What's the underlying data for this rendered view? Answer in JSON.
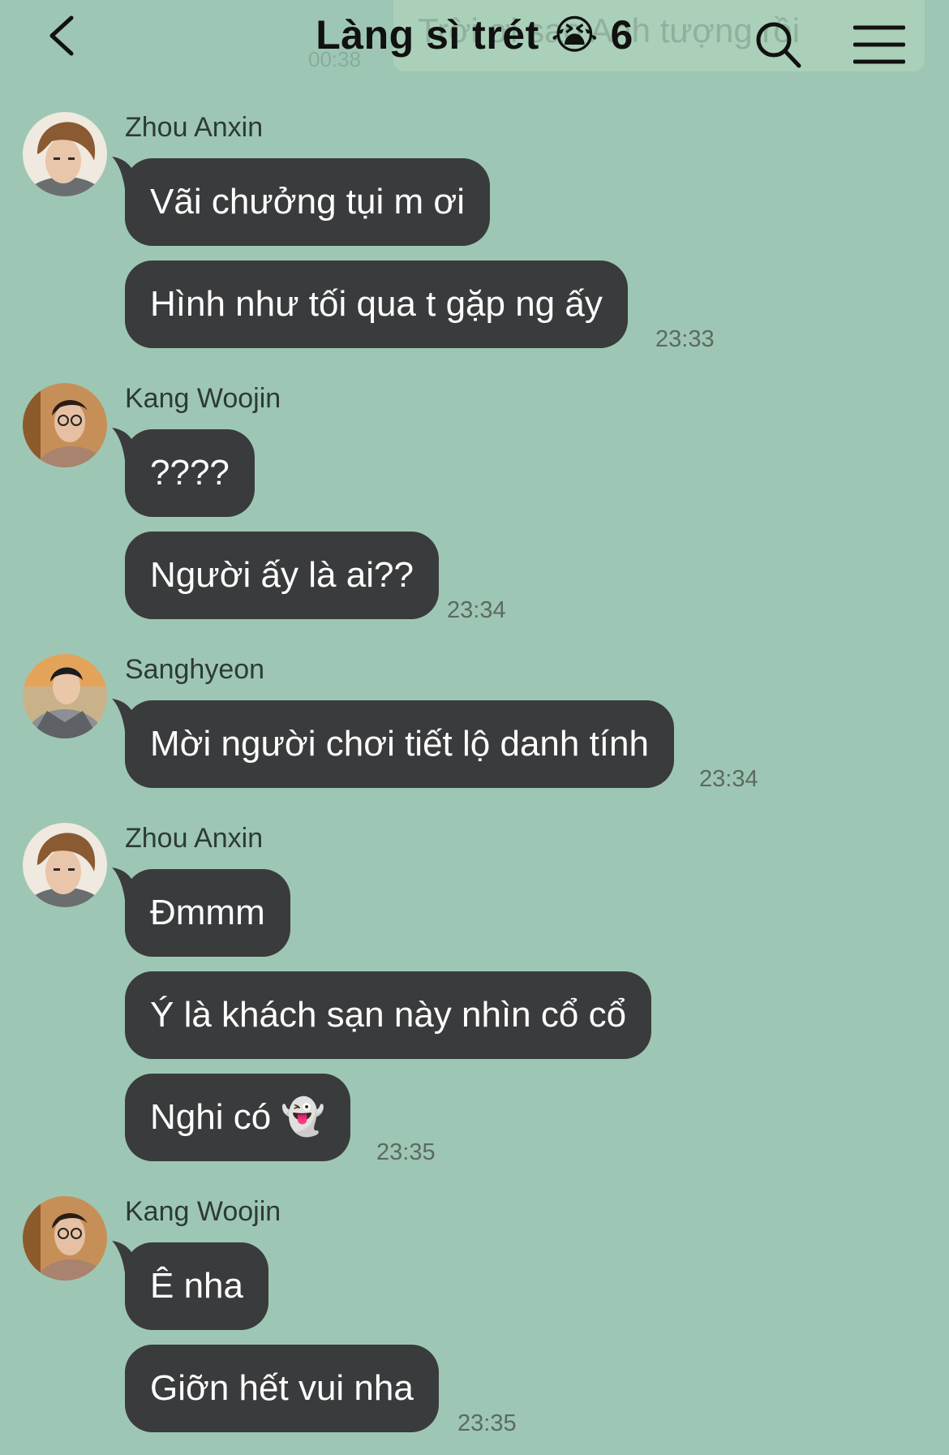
{
  "header": {
    "title": "Làng sì trét 😭 6",
    "ghost_preview_text": "Trời ơi sao Anh tượng rồi",
    "ghost_preview_time": "00:38"
  },
  "groups": [
    {
      "sender": "Zhou Anxin",
      "messages": [
        "Vãi chưởng tụi m ơi",
        "Hình như tối qua t gặp ng ấy"
      ],
      "time": "23:33"
    },
    {
      "sender": "Kang Woojin",
      "messages": [
        "????",
        "Người ấy là ai??"
      ],
      "time": "23:34"
    },
    {
      "sender": "Sanghyeon",
      "messages": [
        "Mời người chơi tiết lộ danh tính"
      ],
      "time": "23:34"
    },
    {
      "sender": "Zhou Anxin",
      "messages": [
        "Đmmm",
        "Ý là khách sạn này nhìn cổ cổ",
        "Nghi có 👻"
      ],
      "time": "23:35"
    },
    {
      "sender": "Kang Woojin",
      "messages": [
        "Ê nha",
        "Giỡn hết vui nha"
      ],
      "time": "23:35"
    }
  ]
}
